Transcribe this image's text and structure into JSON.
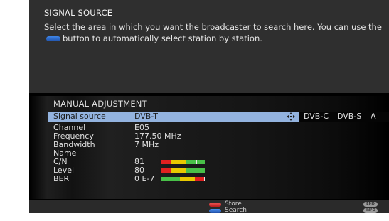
{
  "help": {
    "title": "SIGNAL SOURCE",
    "text_before": "Select the area in which you want the broadcaster to search here. You can use the",
    "text_after": "button to automatically select station by station.",
    "button_icon": "blue-pill-icon"
  },
  "menu": {
    "title": "MANUAL ADJUSTMENT",
    "rows": [
      {
        "label": "Signal source",
        "value": "DVB-T"
      },
      {
        "label": "Channel",
        "value": "E05"
      },
      {
        "label": "Frequency",
        "value": "177.50 MHz"
      },
      {
        "label": "Bandwidth",
        "value": "7 MHz"
      },
      {
        "label": "Name",
        "value": ""
      },
      {
        "label": "C/N",
        "value": "81"
      },
      {
        "label": "Level",
        "value": "80"
      },
      {
        "label": "BER",
        "value": "0 E-7"
      }
    ],
    "options": [
      "DVB-C",
      "DVB-S",
      "A"
    ],
    "nav_icon": "navigation-cross-icon"
  },
  "meters": {
    "cn": 0.81,
    "level": 0.8,
    "ber": 0.05
  },
  "bottom": {
    "store_label": "Store",
    "search_label": "Search",
    "end_badge": "END",
    "info_badge": "INFO"
  },
  "colors": {
    "selected_row": "#93b3df",
    "red_key": "#d83030",
    "blue_key": "#2a6ad0",
    "meter_red": "#e02020",
    "meter_yellow": "#e8c800",
    "meter_green": "#48c048"
  }
}
